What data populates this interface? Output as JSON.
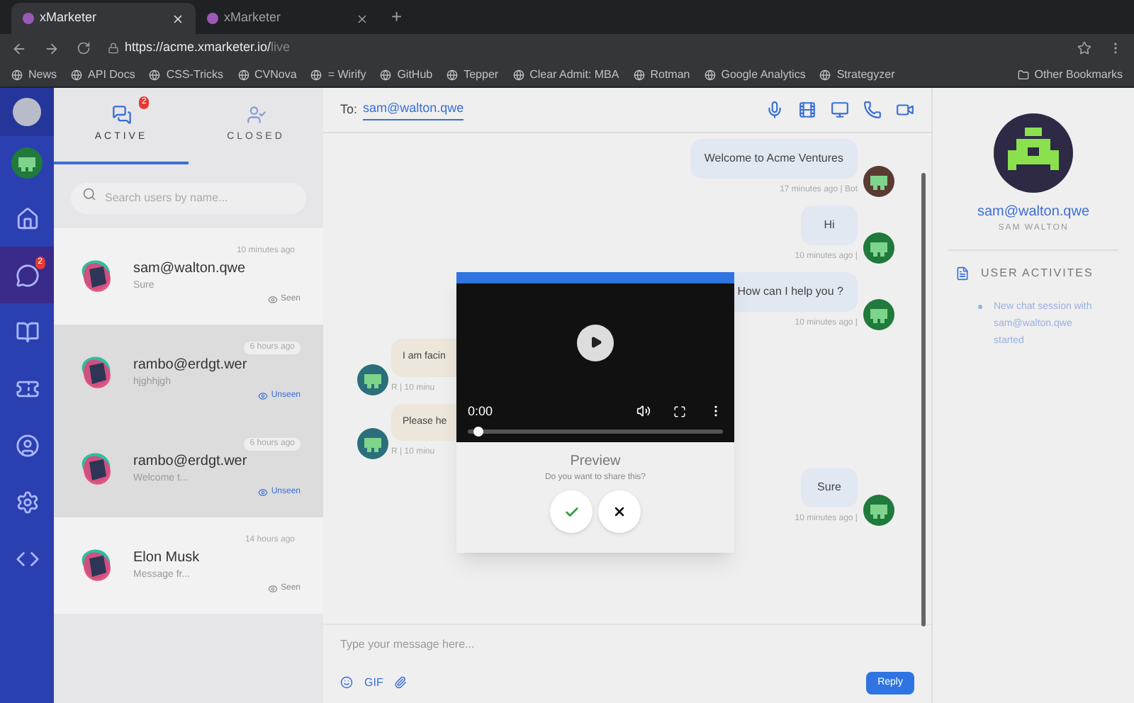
{
  "browser": {
    "tabs": [
      {
        "title": "xMarketer",
        "selected": true
      },
      {
        "title": "xMarketer",
        "selected": false
      }
    ],
    "new_tab": "+",
    "url_host": "https://acme.xmarketer.io/",
    "url_path": "live",
    "bookmarks": [
      "News",
      "API Docs",
      "CSS-Tricks",
      "CVNova",
      "= Wirify",
      "GitHub",
      "Tepper",
      "Clear Admit: MBA",
      "Rotman",
      "Google Analytics",
      "Strategyzer"
    ],
    "other_bookmarks": "Other Bookmarks"
  },
  "rail": {
    "items": [
      {
        "selected": false
      },
      {
        "selected": true,
        "badge": "2"
      },
      {
        "selected": false
      },
      {
        "selected": false
      },
      {
        "selected": false
      },
      {
        "selected": false
      },
      {
        "selected": false
      }
    ]
  },
  "list_tabs": [
    {
      "label": "ACTIVE",
      "selected": true,
      "badge": "2"
    },
    {
      "label": "CLOSED",
      "selected": false
    }
  ],
  "search": {
    "placeholder": "Search users by name..."
  },
  "conversations": [
    {
      "name": "sam@walton.qwe",
      "preview": "Sure",
      "time": "10 minutes ago",
      "status": "Seen",
      "unread": false
    },
    {
      "name": "rambo@erdgt.wer",
      "preview": "hjghhjgh",
      "time": "6 hours ago",
      "status": "Unseen",
      "unread": true
    },
    {
      "name": "rambo@erdgt.wer",
      "preview": "Welcome t...",
      "time": "6 hours ago",
      "status": "Unseen",
      "unread": true
    },
    {
      "name": "Elon Musk",
      "preview": "Message fr...",
      "time": "14 hours ago",
      "status": "Seen",
      "unread": false
    }
  ],
  "chat": {
    "to_label": "To:",
    "to": "sam@walton.qwe",
    "messages": [
      {
        "kind": "outgoing",
        "text": "Welcome to Acme Ventures",
        "meta": "17 minutes ago | Bot"
      },
      {
        "kind": "outgoing",
        "text": "Hi",
        "meta": "10 minutes ago |"
      },
      {
        "kind": "outgoing",
        "text": "How can I help you ?",
        "meta": "10 minutes ago |"
      },
      {
        "kind": "incoming",
        "text": "I am facin",
        "meta": "R | 10 minu"
      },
      {
        "kind": "incoming",
        "text": "Please he",
        "meta": "R | 10 minu"
      },
      {
        "kind": "outgoing",
        "text": "Sure",
        "meta": "10 minutes ago |"
      }
    ],
    "input_placeholder": "Type your message here...",
    "gif": "GIF",
    "reply": "Reply"
  },
  "video_dialog": {
    "time": "0:00",
    "level": 0.02,
    "title": "Preview",
    "question": "Do you want to share this?"
  },
  "profile": {
    "email": "sam@walton.qwe",
    "name": "SAM WALTON",
    "activities_title": "USER ACTIVITES",
    "activities": [
      "New chat session with sam@walton.qwe started"
    ]
  }
}
